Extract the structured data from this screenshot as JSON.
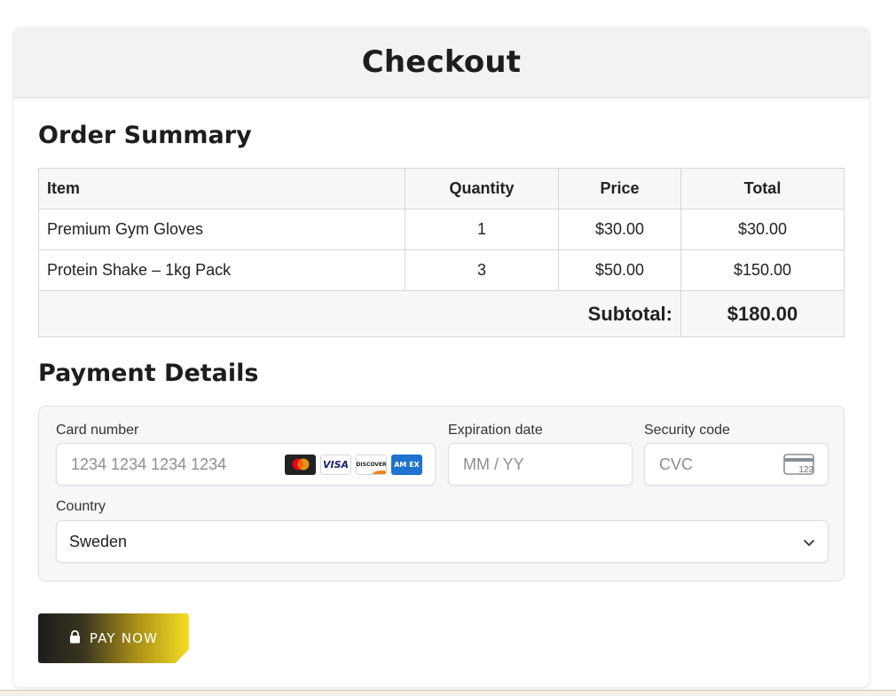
{
  "header": {
    "title": "Checkout"
  },
  "order": {
    "section_title": "Order Summary",
    "columns": [
      "Item",
      "Quantity",
      "Price",
      "Total"
    ],
    "rows": [
      {
        "item": "Premium Gym Gloves",
        "quantity": "1",
        "price": "$30.00",
        "total": "$30.00"
      },
      {
        "item": "Protein Shake – 1kg Pack",
        "quantity": "3",
        "price": "$50.00",
        "total": "$150.00"
      }
    ],
    "subtotal_label": "Subtotal:",
    "subtotal_value": "$180.00"
  },
  "payment": {
    "section_title": "Payment Details",
    "card_number": {
      "label": "Card number",
      "placeholder": "1234 1234 1234 1234",
      "brands": [
        "mastercard-icon",
        "visa-icon",
        "discover-icon",
        "amex-icon"
      ],
      "visa_text": "VISA",
      "discover_text": "DISCOVER",
      "amex_text": "AM EX"
    },
    "expiration": {
      "label": "Expiration date",
      "placeholder": "MM / YY"
    },
    "security_code": {
      "label": "Security code",
      "placeholder": "CVC",
      "icon_text": "123"
    },
    "country": {
      "label": "Country",
      "value": "Sweden"
    }
  },
  "pay_button": {
    "label": "PAY NOW",
    "gradient_start": "#1c1c1c",
    "gradient_end": "#f4dd24"
  }
}
